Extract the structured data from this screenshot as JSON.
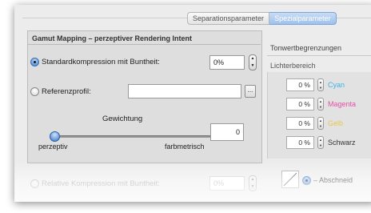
{
  "tabs": [
    {
      "label": "Separationsparameter",
      "active": false
    },
    {
      "label": "Spezialparameter",
      "active": true
    }
  ],
  "gamut": {
    "title": "Gamut Mapping – perzeptiver Rendering Intent",
    "standard_label": "Standardkompression mit Buntheit:",
    "standard_value": "0%",
    "referenz_label": "Referenzprofil:",
    "referenz_value": "",
    "browse_label": "...",
    "gewichtung_label": "Gewichtung",
    "slider_min_label": "perzeptiv",
    "slider_max_label": "farbmetrisch",
    "slider_value": "0",
    "relative_label": "Relative Kompression mit Buntheit:",
    "relative_value": "0%"
  },
  "tonwert": {
    "title": "Tonwertbegrenzungen",
    "lichter_label": "Lichterbereich",
    "channels": [
      {
        "value": "0 %",
        "name": "Cyan",
        "color": "#39b6e6"
      },
      {
        "value": "0 %",
        "name": "Magenta",
        "color": "#ea4fa7"
      },
      {
        "value": "0 %",
        "name": "Gelb",
        "color": "#e8c84a"
      },
      {
        "value": "0 %",
        "name": "Schwarz",
        "color": "#333333"
      }
    ],
    "abschneiden_label": "– Abschneid"
  }
}
